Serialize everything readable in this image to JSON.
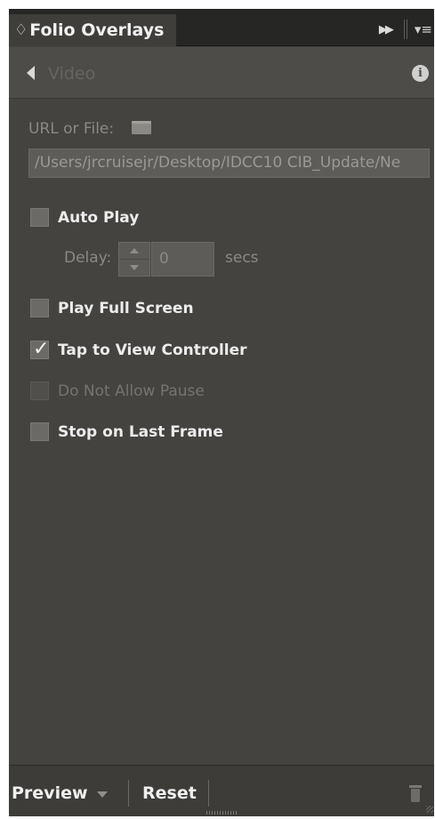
{
  "tabbar": {
    "tab_glyph": "♢",
    "title": "Folio Overlays",
    "collapse_glyph": "▶▶",
    "menu_glyph": "▾≡"
  },
  "header": {
    "title": "Video",
    "info_glyph": "i"
  },
  "url": {
    "label": "URL or File:",
    "path": "/Users/jrcruisejr/Desktop/IDCC10 CIB_Update/Ne"
  },
  "options": {
    "auto_play": {
      "label": "Auto Play",
      "checked": false
    },
    "play_full_screen": {
      "label": "Play Full Screen",
      "checked": false
    },
    "tap_to_view": {
      "label": "Tap to View Controller",
      "checked": true
    },
    "do_not_allow_pause": {
      "label": "Do Not Allow Pause",
      "checked": false,
      "disabled": true
    },
    "stop_on_last_frame": {
      "label": "Stop on Last Frame",
      "checked": false
    }
  },
  "delay": {
    "label": "Delay:",
    "value": "0",
    "unit": "secs"
  },
  "footer": {
    "preview_label": "Preview",
    "reset_label": "Reset"
  },
  "colors": {
    "panel_bg": "#444340",
    "tab_bar_bg": "#262624",
    "text_bright": "#ececec",
    "text_dim": "#8a8984"
  },
  "icons": {
    "back": "back-arrow-icon",
    "info": "info-icon",
    "folder": "folder-icon",
    "trash": "trash-icon"
  }
}
